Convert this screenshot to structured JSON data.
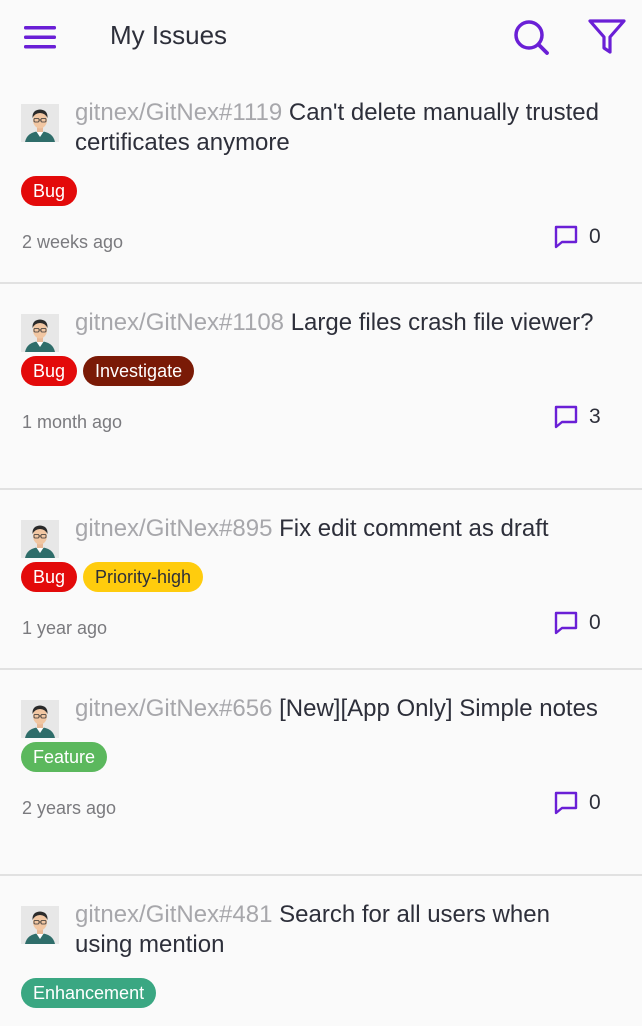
{
  "header": {
    "title": "My Issues"
  },
  "colors": {
    "accent": "#6a1fd6",
    "bug": "#e30a0a",
    "investigate": "#7a1a06",
    "priority_high": "#ffcc0d",
    "feature": "#5bb85d",
    "enhancement": "#3aa782"
  },
  "issues": [
    {
      "ref": "gitnex/GitNex#1119",
      "title": "Can't delete manually trusted certificates anymore",
      "labels": [
        {
          "name": "Bug",
          "color": "#e30a0a",
          "text": "#ffffff"
        }
      ],
      "time": "2 weeks ago",
      "comments": "0"
    },
    {
      "ref": "gitnex/GitNex#1108",
      "title": "Large files crash file viewer?",
      "labels": [
        {
          "name": "Bug",
          "color": "#e30a0a",
          "text": "#ffffff"
        },
        {
          "name": "Investigate",
          "color": "#7a1a06",
          "text": "#ffffff"
        }
      ],
      "time": "1 month ago",
      "comments": "3"
    },
    {
      "ref": "gitnex/GitNex#895",
      "title": "Fix edit comment as draft",
      "labels": [
        {
          "name": "Bug",
          "color": "#e30a0a",
          "text": "#ffffff"
        },
        {
          "name": "Priority-high",
          "color": "#ffcc0d",
          "text": "#2d2f3a"
        }
      ],
      "time": "1 year ago",
      "comments": "0"
    },
    {
      "ref": "gitnex/GitNex#656",
      "title": "[New][App Only] Simple notes",
      "labels": [
        {
          "name": "Feature",
          "color": "#5bb85d",
          "text": "#ffffff"
        }
      ],
      "time": "2 years ago",
      "comments": "0"
    },
    {
      "ref": "gitnex/GitNex#481",
      "title": "Search for all users when using mention",
      "labels": [
        {
          "name": "Enhancement",
          "color": "#3aa782",
          "text": "#ffffff"
        }
      ],
      "time": "",
      "comments": ""
    }
  ]
}
